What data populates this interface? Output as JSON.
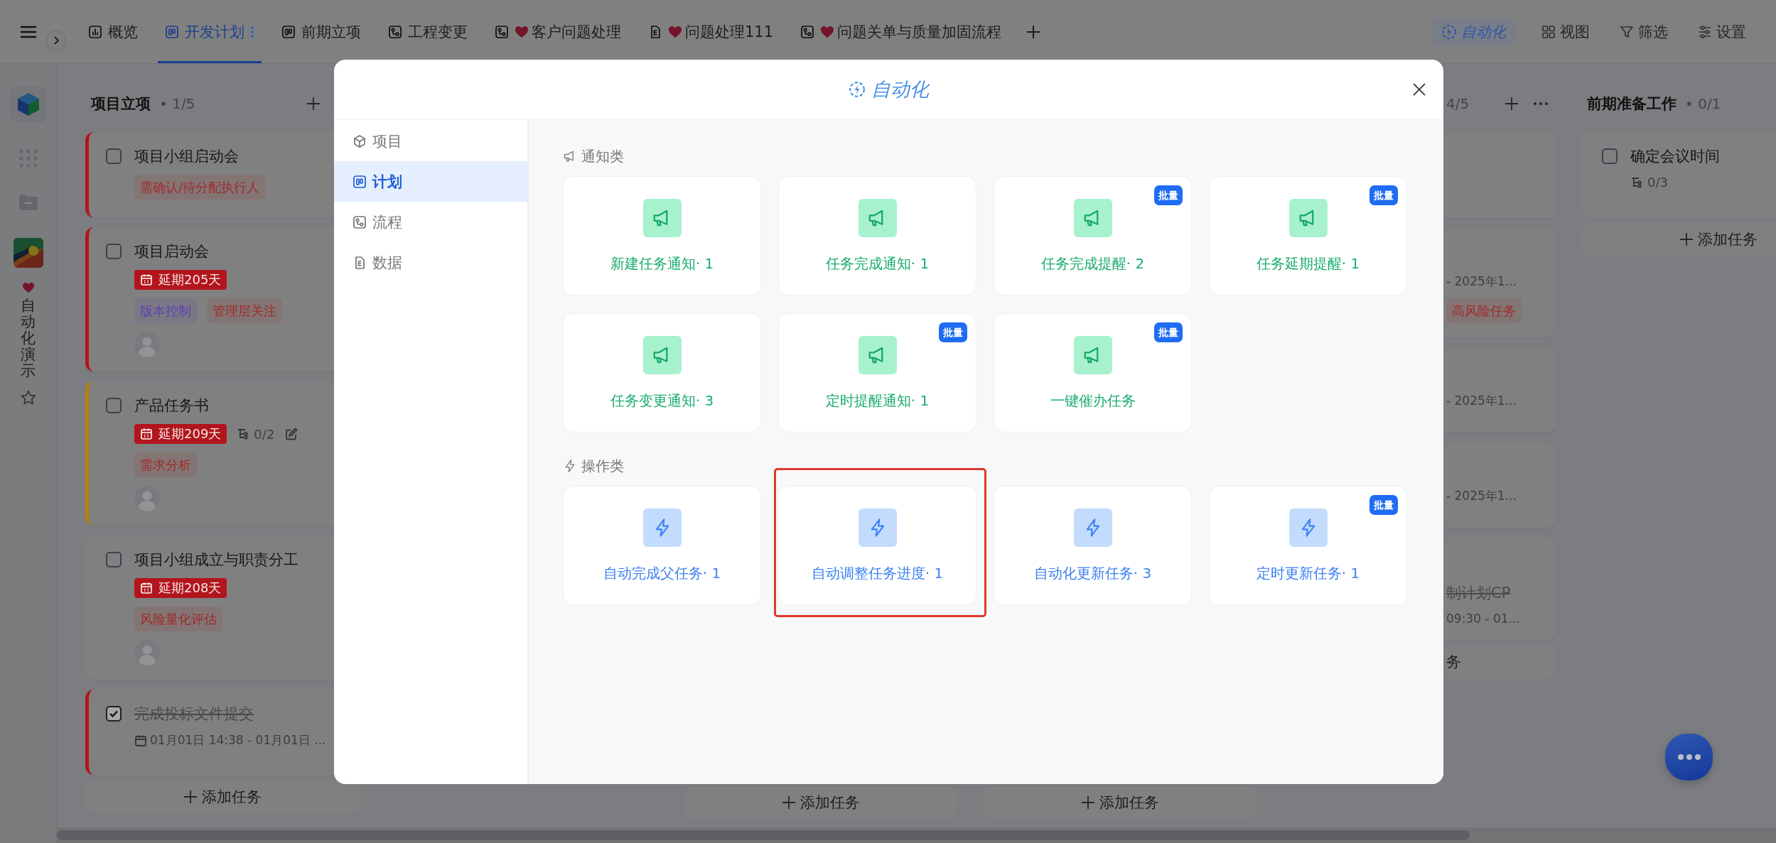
{
  "topbar": {
    "tabs": [
      {
        "label": "概览",
        "kind": "chart",
        "heart": false,
        "selected": false
      },
      {
        "label": "开发计划",
        "kind": "board",
        "heart": false,
        "selected": true
      },
      {
        "label": "前期立项",
        "kind": "board",
        "heart": false,
        "selected": false
      },
      {
        "label": "工程变更",
        "kind": "flow",
        "heart": false,
        "selected": false
      },
      {
        "label": "客户问题处理",
        "kind": "flow",
        "heart": true,
        "selected": false
      },
      {
        "label": "问题处理111",
        "kind": "doc",
        "heart": true,
        "selected": false
      },
      {
        "label": "问题关单与质量加固流程",
        "kind": "flow",
        "heart": true,
        "selected": false
      }
    ],
    "tools": [
      {
        "label": "自动化",
        "kind": "automation",
        "selected": true
      },
      {
        "label": "视图",
        "kind": "view",
        "selected": false
      },
      {
        "label": "筛选",
        "kind": "filter",
        "selected": false
      },
      {
        "label": "设置",
        "kind": "settings",
        "selected": false
      }
    ]
  },
  "app": {
    "name": "自动化演示",
    "heart": true
  },
  "columns": [
    {
      "title": "项目立项",
      "count": "• 1/5",
      "add_button": true,
      "cards": [
        {
          "color": "#b3151d",
          "checked": false,
          "done": false,
          "title": "项目小组启动会",
          "tags": [
            {
              "text": "需确认/待分配执行人",
              "color": "#a02a2a"
            }
          ]
        },
        {
          "color": "#b3151d",
          "checked": false,
          "done": false,
          "title": "项目启动会",
          "meta": [
            {
              "kind": "delay",
              "text": "延期205天"
            }
          ],
          "tags": [
            {
              "text": "版本控制",
              "color": "#5b40b0"
            },
            {
              "text": "管理层关注",
              "color": "#a02a2a"
            }
          ],
          "avatar": true
        },
        {
          "color": "#b8800c",
          "checked": false,
          "done": false,
          "title": "产品任务书",
          "meta": [
            {
              "kind": "delay",
              "text": "延期209天"
            },
            {
              "kind": "subtasks",
              "text": "0/2"
            },
            {
              "kind": "edit"
            }
          ],
          "tags": [
            {
              "text": "需求分析",
              "color": "#a02a2a"
            }
          ],
          "avatar": true
        },
        {
          "checked": false,
          "done": false,
          "title": "项目小组成立与职责分工",
          "meta": [
            {
              "kind": "delay",
              "text": "延期208天"
            }
          ],
          "tags": [
            {
              "text": "风险量化评估",
              "color": "#a02a2a"
            }
          ],
          "avatar": true
        },
        {
          "color": "#b3151d",
          "checked": true,
          "done": true,
          "title": "完成投标文件提交",
          "meta": [
            {
              "kind": "date",
              "text": "01月01日 14:38 - 01月01日 ..."
            }
          ]
        }
      ],
      "add_task": "添加任务"
    },
    {
      "add_task": "添加任务"
    },
    {
      "add_task": "添加任务"
    },
    {
      "count": "4/5",
      "add_button": true,
      "more_button": true,
      "cards": [
        {
          "meta": [
            {
              "kind": "date",
              "text": "- 2025年1..."
            }
          ],
          "tags": [
            {
              "text": "高风险任务",
              "color": "#a02a2a"
            }
          ]
        },
        {
          "meta": [
            {
              "kind": "date",
              "text": "- 2025年1..."
            }
          ]
        },
        {
          "meta": [
            {
              "kind": "date",
              "text": "- 2025年1..."
            }
          ]
        },
        {
          "done": true,
          "title": "制计划CP",
          "meta": [
            {
              "kind": "date",
              "text": "09:30 - 01..."
            }
          ]
        }
      ],
      "add_task": "务"
    },
    {
      "title": "前期准备工作",
      "count": "• 0/1",
      "cards": [
        {
          "checked": false,
          "done": false,
          "title": "确定会议时间",
          "meta": [
            {
              "kind": "subtasks",
              "text": "0/3"
            }
          ]
        }
      ],
      "add_task": "添加任务"
    }
  ],
  "dialog": {
    "title": "自动化",
    "nav": [
      {
        "label": "项目",
        "kind": "module",
        "selected": false
      },
      {
        "label": "计划",
        "kind": "board",
        "selected": true
      },
      {
        "label": "流程",
        "kind": "flow",
        "selected": false
      },
      {
        "label": "数据",
        "kind": "doc",
        "selected": false
      }
    ],
    "sections": [
      {
        "title": "通知类",
        "kind": "notify",
        "items": [
          {
            "label": "新建任务通知· 1",
            "highlighted": false
          },
          {
            "label": "任务完成通知· 1",
            "highlighted": false
          },
          {
            "label": "任务完成提醒· 2",
            "badge": "批量",
            "highlighted": false
          },
          {
            "label": "任务延期提醒· 1",
            "badge": "批量",
            "highlighted": false
          },
          {
            "label": "任务变更通知· 3",
            "highlighted": false
          },
          {
            "label": "定时提醒通知· 1",
            "badge": "批量",
            "highlighted": false
          },
          {
            "label": "一键催办任务",
            "badge": "批量",
            "highlighted": false
          }
        ]
      },
      {
        "title": "操作类",
        "kind": "action",
        "items": [
          {
            "label": "自动完成父任务· 1",
            "highlighted": false
          },
          {
            "label": "自动调整任务进度· 1",
            "highlighted": true
          },
          {
            "label": "自动化更新任务· 3",
            "highlighted": false
          },
          {
            "label": "定时更新任务· 1",
            "badge": "批量",
            "highlighted": false
          }
        ]
      }
    ]
  }
}
